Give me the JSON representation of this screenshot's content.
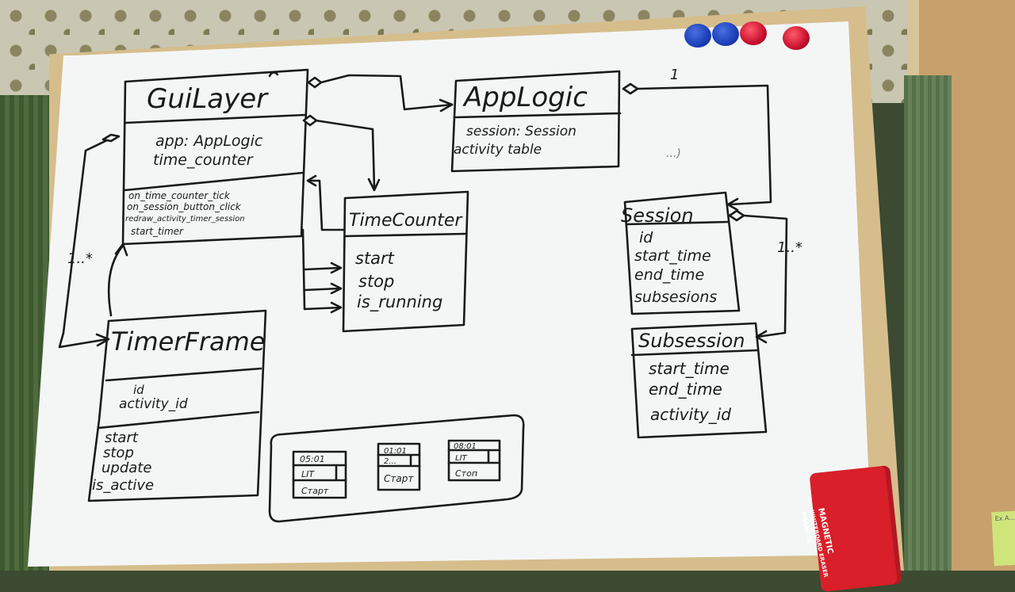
{
  "classes": {
    "guilayer": {
      "name": "GuiLayer",
      "attributes": [
        "app: AppLogic",
        "time_counter"
      ],
      "methods": [
        "on_time_counter_tick",
        "on_session_button_click",
        "redraw_activity_timer_session",
        "start_timer"
      ]
    },
    "applogic": {
      "name": "AppLogic",
      "attributes": [
        "session: Session",
        "activity table"
      ]
    },
    "timecounter": {
      "name": "TimeCounter",
      "methods": [
        "start",
        "stop",
        "is_running"
      ]
    },
    "session": {
      "name": "Session",
      "attributes": [
        "id",
        "start_time",
        "end_time",
        "subsesions"
      ]
    },
    "subsession": {
      "name": "Subsession",
      "attributes": [
        "start_time",
        "end_time",
        "activity_id"
      ]
    },
    "timerframe": {
      "name": "TimerFrame",
      "attributes": [
        "id",
        "activity_id"
      ],
      "methods": [
        "start",
        "stop",
        "update",
        "is_active"
      ]
    }
  },
  "multiplicities": {
    "applogic_session": "1",
    "session_subsession": "1..*",
    "guilayer_timerframe": "1..*",
    "applogic_note": "...)"
  },
  "sketches": [
    {
      "time": "05:01",
      "activity": "LIT",
      "button": "Cтарт"
    },
    {
      "time": "01:01",
      "activity": "2...",
      "button": "Cтарт"
    },
    {
      "time": "08:01",
      "activity": "LIT",
      "button": "Cтоп"
    }
  ],
  "eraser": {
    "brand": "MAGNETIC",
    "line2": "WHITEBOARD ERASER",
    "line3": "MAGNETIC"
  },
  "sticky": {
    "text": "Ex A..."
  },
  "colors": {
    "ink": "#1a1a1a",
    "magnet_blue": "#1b3fb8",
    "magnet_red": "#c8102e",
    "eraser": "#d81f2a"
  }
}
